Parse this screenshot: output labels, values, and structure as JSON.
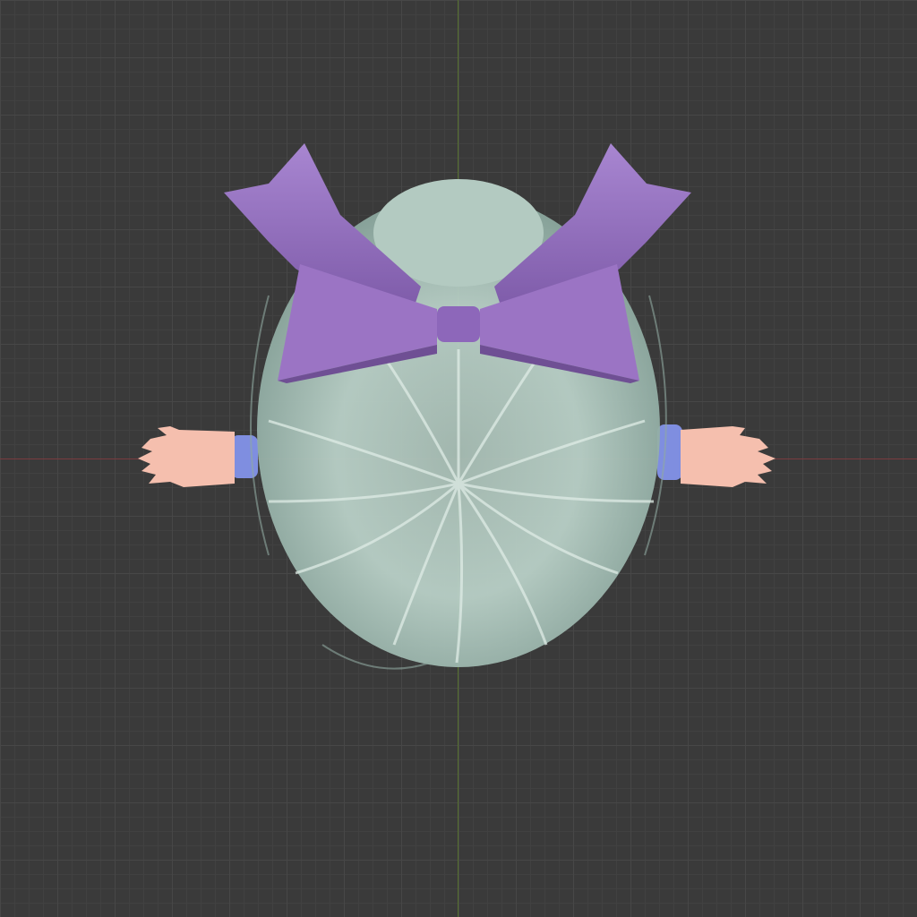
{
  "viewport": {
    "background": "#3a3a3a",
    "grid_minor": "#414141",
    "grid_major": "#474747",
    "axis_x_color": "#7a3b3f",
    "axis_y_color": "#56702e"
  },
  "model": {
    "hair_color": "#b8cfc6",
    "hair_shadow": "#8fa9a0",
    "bow_color": "#9b74c4",
    "bow_shadow": "#6f4f94",
    "skin_color": "#f5bfae",
    "sleeve_color": "#7f8ee0"
  }
}
